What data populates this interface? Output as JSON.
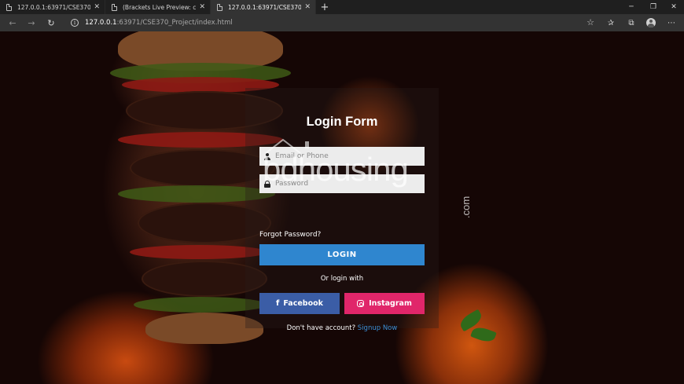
{
  "browser": {
    "tabs": [
      {
        "label": "127.0.0.1:63971/CSE370_Project/",
        "active": false
      },
      {
        "label": "(Brackets Live Preview: closed)",
        "active": false
      },
      {
        "label": "127.0.0.1:63971/CSE370_Project/",
        "active": true
      }
    ],
    "new_tab": "+",
    "address": {
      "host": "127.0.0.1",
      "path": ":63971/CSE370_Project/index.html"
    }
  },
  "watermark": {
    "text": "bdhousing",
    "domain": ".com"
  },
  "login": {
    "title": "Login Form",
    "email_placeholder": "Email or Phone",
    "password_placeholder": "Password",
    "forgot": "Forgot Password?",
    "login_button": "LOGIN",
    "or_text": "Or login with",
    "facebook_button": "Facebook",
    "instagram_button": "Instagram",
    "signup_prompt": "Don't have account?",
    "signup_link": "Signup Now"
  },
  "colors": {
    "login_button": "#2f86cf",
    "facebook": "#3b5da6",
    "instagram": "#e0266a",
    "link": "#3b8fd6"
  }
}
